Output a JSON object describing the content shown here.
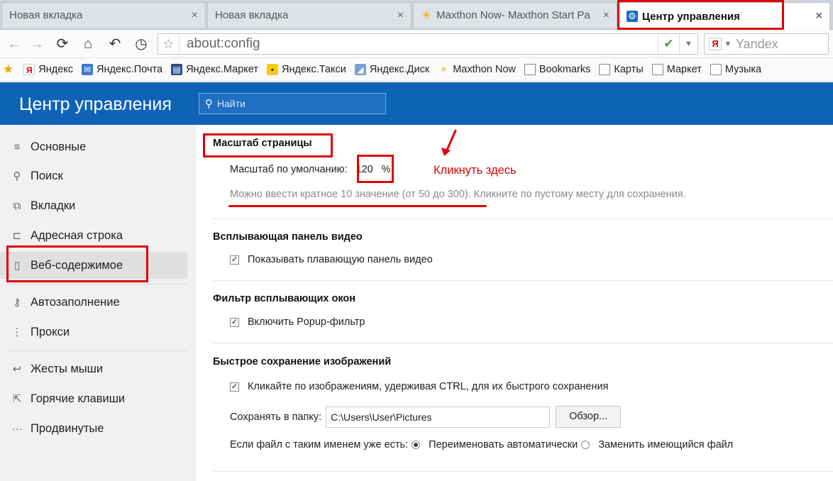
{
  "tabs": [
    {
      "label": "Новая вкладка",
      "close": "×",
      "active": false
    },
    {
      "label": "Новая вкладка",
      "close": "×",
      "active": false
    },
    {
      "label": "Maxthon Now- Maxthon Start Pa",
      "close": "×",
      "active": false
    },
    {
      "label": "Центр управления",
      "close": "×",
      "active": true
    }
  ],
  "navbar": {
    "back": "←",
    "forward": "→",
    "reload": "⟳",
    "home": "⌂",
    "undo": "↶",
    "history": "◷",
    "bookmark_star": "☆",
    "url": "about:config",
    "pin": "✔",
    "dropdown": "▼",
    "search_engine_logo": "Я",
    "search_engine_drop": "▼",
    "search_engine": "Yandex"
  },
  "bookmarks": {
    "star": "★",
    "items": [
      {
        "label": "Яндекс",
        "icon": "yandex-icon",
        "glyph": "Я"
      },
      {
        "label": "Яндекс.Почта",
        "icon": "mail-icon",
        "glyph": "✉"
      },
      {
        "label": "Яндекс.Маркет",
        "icon": "market-icon",
        "glyph": "▤"
      },
      {
        "label": "Яндекс.Такси",
        "icon": "taxi-icon",
        "glyph": "▪"
      },
      {
        "label": "Яндекс.Диск",
        "icon": "disk-icon",
        "glyph": "◢"
      },
      {
        "label": "Maxthon Now",
        "icon": "sun-icon",
        "glyph": "☀"
      },
      {
        "label": "Bookmarks",
        "icon": "page-icon",
        "glyph": ""
      },
      {
        "label": "Карты",
        "icon": "page-icon",
        "glyph": ""
      },
      {
        "label": "Маркет",
        "icon": "page-icon",
        "glyph": ""
      },
      {
        "label": "Музыка",
        "icon": "page-icon",
        "glyph": ""
      }
    ]
  },
  "header": {
    "title": "Центр управления",
    "search_icon": "⚲",
    "search_placeholder": "Найти"
  },
  "sidebar": {
    "items": [
      {
        "label": "Основные",
        "icon": "sliders-icon",
        "glyph": "≡"
      },
      {
        "label": "Поиск",
        "icon": "search-icon",
        "glyph": "⚲"
      },
      {
        "label": "Вкладки",
        "icon": "tabs-icon",
        "glyph": "⧉"
      },
      {
        "label": "Адресная строка",
        "icon": "address-bar-icon",
        "glyph": "⊏"
      },
      {
        "label": "Веб-содержимое",
        "icon": "document-icon",
        "glyph": "▯"
      },
      {
        "label": "Автозаполнение",
        "icon": "key-icon",
        "glyph": "⚷"
      },
      {
        "label": "Прокси",
        "icon": "proxy-icon",
        "glyph": "⋮"
      },
      {
        "label": "Жесты мыши",
        "icon": "gesture-icon",
        "glyph": "↩"
      },
      {
        "label": "Горячие клавиши",
        "icon": "hotkey-icon",
        "glyph": "⇱"
      },
      {
        "label": "Продвинутые",
        "icon": "more-icon",
        "glyph": "···"
      }
    ]
  },
  "main": {
    "zoom": {
      "title": "Масштаб страницы",
      "label": "Масштаб по умолчанию:",
      "value": "120",
      "unit": "%",
      "hint": "Можно ввести кратное 10 значение (от 50 до 300). Кликните по пустому месту для сохранения."
    },
    "video": {
      "title": "Всплывающая панель видео",
      "checkbox_label": "Показывать плавающую панель видео",
      "check_mark": "✓"
    },
    "popup": {
      "title": "Фильтр всплывающих окон",
      "checkbox_label": "Включить Popup-фильтр",
      "check_mark": "✓"
    },
    "image_save": {
      "title": "Быстрое сохранение изображений",
      "checkbox_label": "Кликайте по изображениям, удерживая CTRL, для их быстрого сохранения",
      "check_mark": "✓",
      "folder_label": "Сохранять в папку:",
      "folder_path": "C:\\Users\\User\\Pictures",
      "browse_label": "Обзор...",
      "exists_label": "Если файл с таким именем уже есть:",
      "option_rename": "Переименовать автоматически",
      "option_replace": "Заменить имеющийся файл"
    }
  },
  "annotation": {
    "note": "Кликнуть здесь",
    "color": "#e00000"
  },
  "colors": {
    "header_bg": "#0f63b7",
    "sidebar_bg": "#f1f1f1",
    "accent_red": "#e00000"
  }
}
